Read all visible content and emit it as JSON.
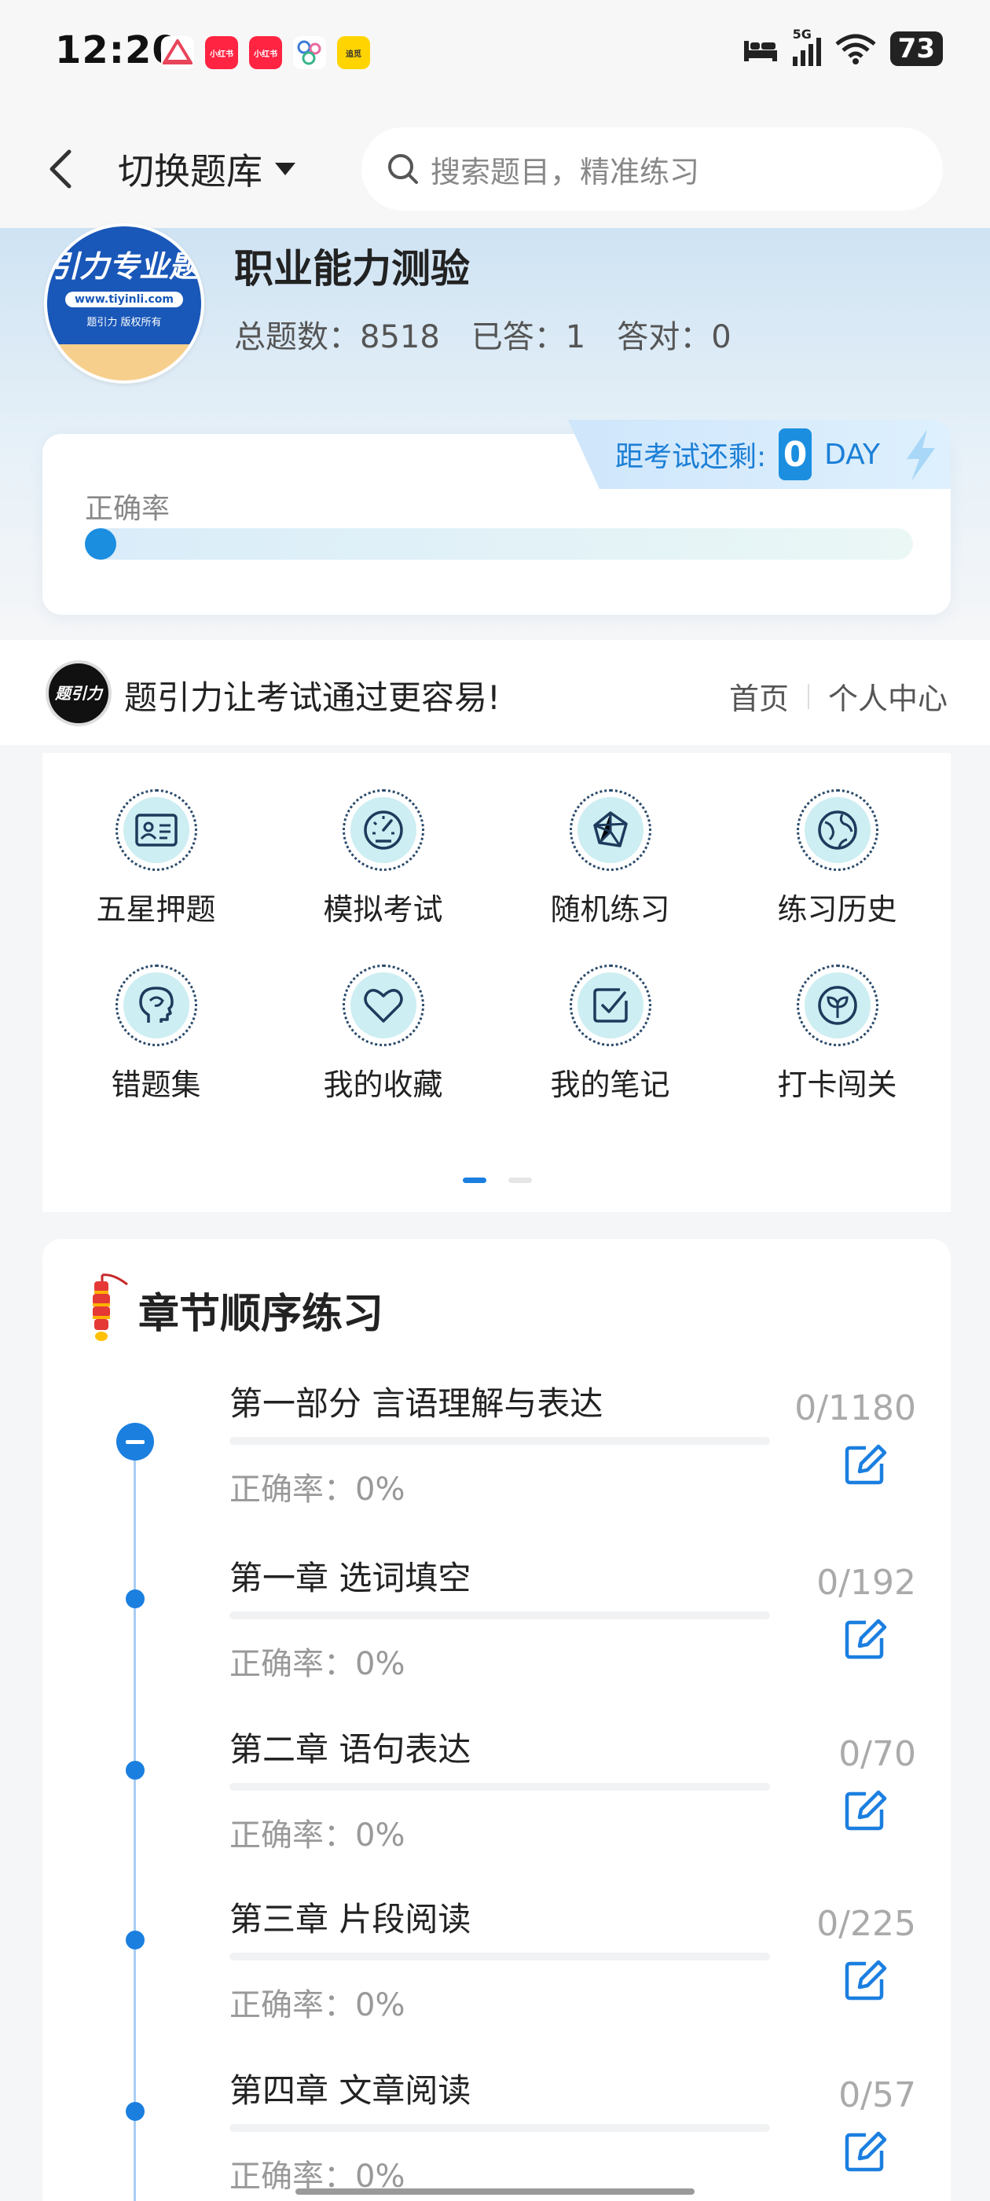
{
  "status_bar": {
    "time": "12:20",
    "notifications": [
      {
        "icon": "app-triangle-icon",
        "color": "#e8455a",
        "label": ""
      },
      {
        "icon": "xiaohongshu-icon",
        "color": "#ff2442",
        "label": "小红书"
      },
      {
        "icon": "xiaohongshu-icon",
        "color": "#ff2442",
        "label": "小红书"
      },
      {
        "icon": "app-dots-icon",
        "color": "#ffffff",
        "label": ""
      },
      {
        "icon": "app-yellow-icon",
        "color": "#ffd400",
        "label": "追觅"
      }
    ],
    "network": "5G",
    "battery": "73"
  },
  "nav": {
    "switch_label": "切换题库",
    "search_placeholder": "搜索题目，精准练习"
  },
  "exam": {
    "logo_title": "引力专业题",
    "logo_url": "www.tiyinli.com",
    "logo_copyright": "题引力 版权所有",
    "title": "职业能力测验",
    "total": "总题数：8518",
    "answered": "已答：1",
    "correct": "答对：0"
  },
  "countdown": {
    "label": "距考试还剩:",
    "days": "0",
    "unit": "DAY"
  },
  "accuracy": {
    "label": "正确率",
    "value": 0
  },
  "brand": {
    "logo_text": "题引力",
    "slogan": "题引力让考试通过更容易!",
    "link_home": "首页",
    "link_profile": "个人中心"
  },
  "functions": [
    {
      "label": "五星押题",
      "icon": "id-card-icon"
    },
    {
      "label": "模拟考试",
      "icon": "speedometer-icon"
    },
    {
      "label": "随机练习",
      "icon": "network-icon"
    },
    {
      "label": "练习历史",
      "icon": "globe-icon"
    },
    {
      "label": "错题集",
      "icon": "head-icon"
    },
    {
      "label": "我的收藏",
      "icon": "heart-icon"
    },
    {
      "label": "我的笔记",
      "icon": "note-check-icon"
    },
    {
      "label": "打卡闯关",
      "icon": "sprout-icon"
    }
  ],
  "pager": {
    "pages": 2,
    "current": 1
  },
  "chapters": {
    "title": "章节顺序练习",
    "items": [
      {
        "name": "第一部分 言语理解与表达",
        "accuracy": "正确率：0%",
        "count": "0/1180"
      },
      {
        "name": "第一章 选词填空",
        "accuracy": "正确率：0%",
        "count": "0/192"
      },
      {
        "name": "第二章 语句表达",
        "accuracy": "正确率：0%",
        "count": "0/70"
      },
      {
        "name": "第三章 片段阅读",
        "accuracy": "正确率：0%",
        "count": "0/225"
      },
      {
        "name": "第四章 文章阅读",
        "accuracy": "正确率：0%",
        "count": "0/57"
      }
    ]
  },
  "colors": {
    "accent": "#1b8ee0",
    "logo_blue": "#1957b8",
    "icon_bg": "#cdeef2"
  }
}
